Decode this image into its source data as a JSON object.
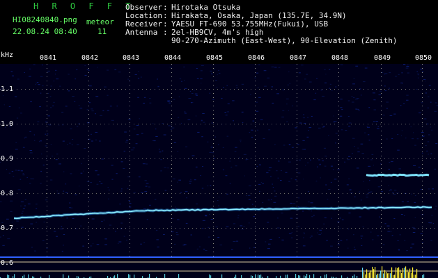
{
  "header": {
    "logo": "H R O F F T",
    "filename": "HI08240840.png",
    "datetime": "22.08.24 08:40",
    "meteor_label": "meteor",
    "meteor_count": "11",
    "info": [
      {
        "key": "Observer ",
        "value": "Hirotaka Otsuka"
      },
      {
        "key": "Location ",
        "value": "Hirakata, Osaka, Japan (135.7E, 34.9N)"
      },
      {
        "key": "Receiver ",
        "value": "YAESU FT-690 53.755MHz(Fukui), USB"
      },
      {
        "key": "Antenna  ",
        "value": "2el-HB9CV, 4m's high"
      },
      {
        "key": "",
        "value": "90-270-Azimuth (East-West), 90-Elevation (Zenith)"
      }
    ]
  },
  "axes": {
    "y_unit": "kHz",
    "x_ticks": [
      "0841",
      "0842",
      "0843",
      "0844",
      "0845",
      "0846",
      "0847",
      "0848",
      "0849",
      "0850"
    ],
    "y_ticks": [
      "1.1",
      "1.0",
      "0.9",
      "0.8",
      "0.7",
      "0.6"
    ]
  },
  "colors": {
    "background": "#00001a",
    "trace": "#7fe6ff",
    "trace_core": "#3fb0ff",
    "grid_dots": "#aaaaaa",
    "burst": "#ffee33",
    "hline": "#d8c9a0"
  }
}
